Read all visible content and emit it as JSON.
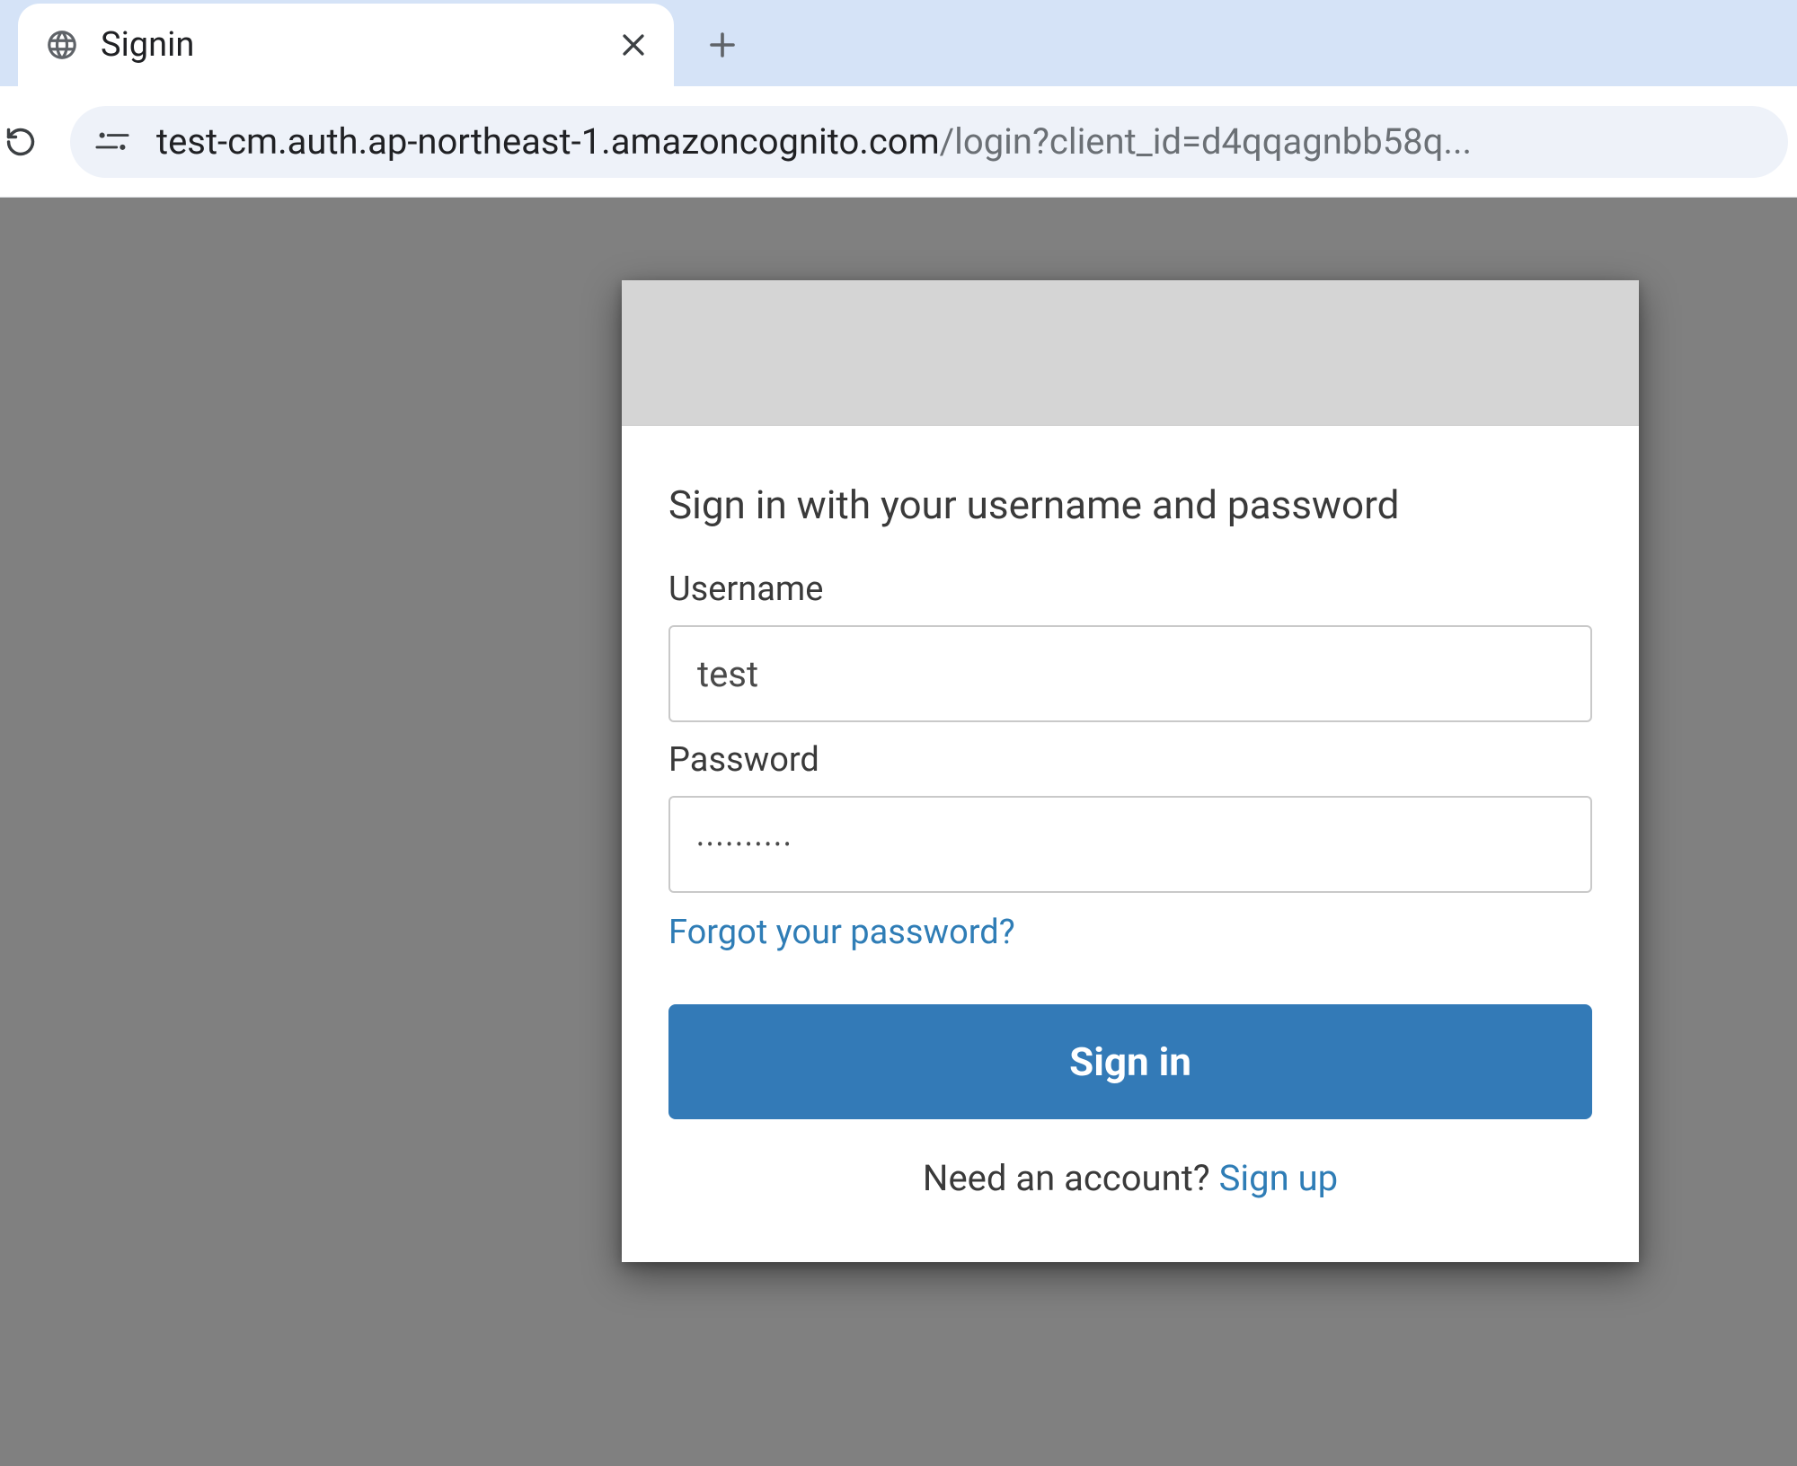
{
  "browser": {
    "tab_title": "Signin",
    "url_host": "test-cm.auth.ap-northeast-1.amazoncognito.com",
    "url_path": "/login?client_id=d4qqagnbb58q..."
  },
  "login": {
    "heading": "Sign in with your username and password",
    "username_label": "Username",
    "username_value": "test",
    "password_label": "Password",
    "password_value": "••••••••••",
    "forgot_link": "Forgot your password?",
    "submit_label": "Sign in",
    "need_account_text": "Need an account?",
    "signup_link": "Sign up"
  },
  "colors": {
    "accent": "#337ab7",
    "link": "#2f7db6",
    "page_bg": "#808080"
  }
}
